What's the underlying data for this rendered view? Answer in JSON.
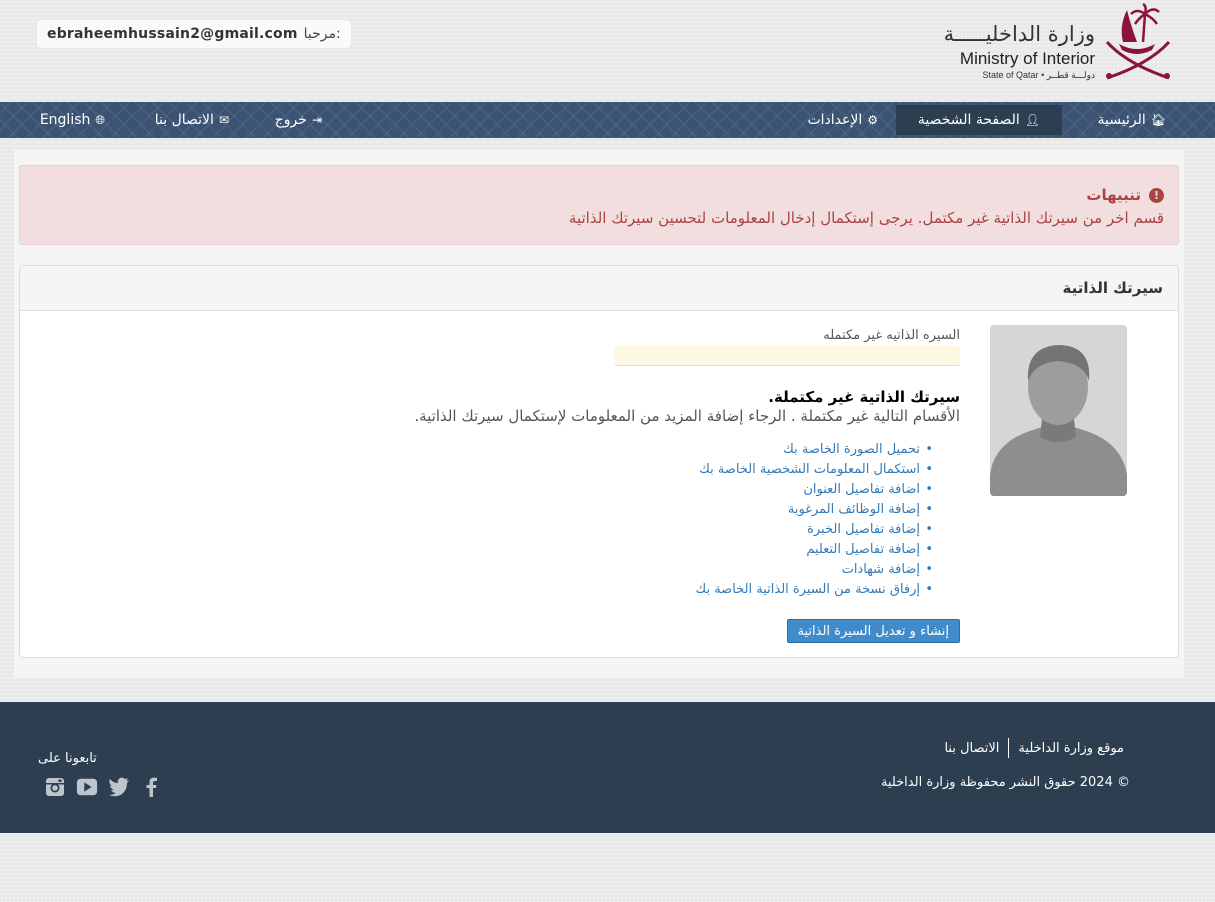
{
  "header": {
    "greeting_label": "مرحبا:",
    "user_email": "ebraheemhussain2@gmail.com",
    "logo": {
      "arabic_name": "وزارة الداخليـــــة",
      "english_name": "Ministry of Interior",
      "state_en": "State of Qatar",
      "state_ar": "دولـــة قطــر"
    }
  },
  "nav": {
    "home": "الرئيسية",
    "profile": "الصفحة الشخصية",
    "settings": "الإعدادات",
    "logout": "خروج",
    "contact": "الاتصال بنا",
    "language": "English"
  },
  "alert": {
    "title": "تنبيهات",
    "message": "قسم اخر من سيرتك الذاتية غير مكتمل. يرجى إستكمال إدخال المعلومات لتحسين سيرتك الذاتية"
  },
  "cv_panel": {
    "title": "سيرتك الذاتية",
    "progress_label": "السيره الذاتيه غير مكتمله",
    "progress_fraction": 0,
    "incomplete_title": "سيرتك الذاتية غير مكتملة.",
    "incomplete_subtitle": "الأقسام التالية غير مكتملة . الرجاء إضافة المزيد من المعلومات لإستكمال سيرتك الذاتية.",
    "tasks": [
      "تحميل الصورة الخاصة بك",
      "استكمال المعلومات الشخصية الخاصة بك",
      "اضافة تفاصيل العنوان",
      "إضافة الوظائف المرغوبة",
      "إضافة تفاصيل الخبرة",
      "إضافة تفاصيل التعليم",
      "إضافة شهادات",
      "إرفاق نسخة من السيرة الذاتية الخاصة بك"
    ],
    "create_button": "إنشاء و تعديل السيرة الذاتية"
  },
  "footer": {
    "links": [
      "موقع وزارة الداخلية",
      "الاتصال بنا"
    ],
    "copyright": "© 2024 حقوق النشر محفوظة وزارة الداخلية",
    "follow_us": "تابعونا على",
    "social_icons": [
      "facebook-icon",
      "twitter-icon",
      "youtube-icon",
      "instagram-icon"
    ]
  },
  "colors": {
    "nav_bg": "#3b5373",
    "nav_active": "#2c3e50",
    "alert_bg": "#f2dede",
    "alert_text": "#a94442",
    "link": "#337ab7",
    "button": "#428bca",
    "footer_bg": "#2c3e50",
    "logo_maroon": "#8a1538"
  }
}
